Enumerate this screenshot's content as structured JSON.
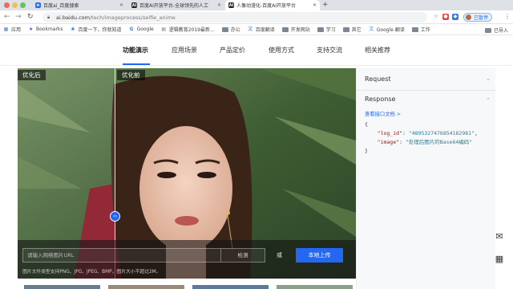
{
  "browser": {
    "tabs": [
      {
        "title": "百度ai_百度搜索",
        "active": false,
        "favicon_color": "#2d6be4"
      },
      {
        "title": "百度AI开放平台-全球领先的人工",
        "active": false,
        "favicon_color": "#222"
      },
      {
        "title": "人像动漫化-百度AI开放平台",
        "active": true,
        "favicon_color": "#222"
      }
    ],
    "new_tab": "+",
    "url_domain": "ai.baidu.com",
    "url_path": "/tech/imageprocess/selfie_anime",
    "profile_label": "已暂停",
    "bookmarks": [
      {
        "label": "应用",
        "icon": "grid-icon"
      },
      {
        "label": "Bookmarks",
        "icon": "star-icon"
      },
      {
        "label": "百度一下，你就知道",
        "icon": "paw-icon"
      },
      {
        "label": "Google",
        "icon": "google-icon"
      },
      {
        "label": "逻辑教育2019最新...",
        "icon": "page-icon"
      },
      {
        "label": "办公",
        "icon": "folder-icon"
      },
      {
        "label": "百度翻译",
        "icon": "translate-icon"
      },
      {
        "label": "开发网站",
        "icon": "folder-icon"
      },
      {
        "label": "学习",
        "icon": "folder-icon"
      },
      {
        "label": "其它",
        "icon": "folder-icon"
      },
      {
        "label": "Google 翻译",
        "icon": "translate-icon"
      },
      {
        "label": "工作",
        "icon": "folder-icon"
      }
    ],
    "bookmarks_right": "已导入"
  },
  "site_nav": {
    "items": [
      "功能演示",
      "应用场景",
      "产品定价",
      "使用方式",
      "支持交流",
      "相关推荐"
    ],
    "active_index": 0
  },
  "demo": {
    "label_after": "优化后",
    "label_before": "优化前",
    "url_placeholder": "请输入网络图片URL",
    "detect_button": "检测",
    "or_text": "或",
    "upload_button": "本地上传",
    "hint": "图片文件类型支持PNG、JPG、JPEG、BMP，图片大小不超过2M。"
  },
  "panel": {
    "request_label": "Request",
    "response_label": "Response",
    "doc_link": "查看接口文档 >",
    "json_open": "{",
    "log_id_key": "\"log_id\"",
    "log_id_value": "\"4895327476854182981\"",
    "image_key": "\"image\"",
    "image_value": "\"处理后图片的Base64编码\"",
    "json_close": "}"
  },
  "colors": {
    "accent": "#2468f2",
    "tab_strip": "#dee1e6"
  }
}
